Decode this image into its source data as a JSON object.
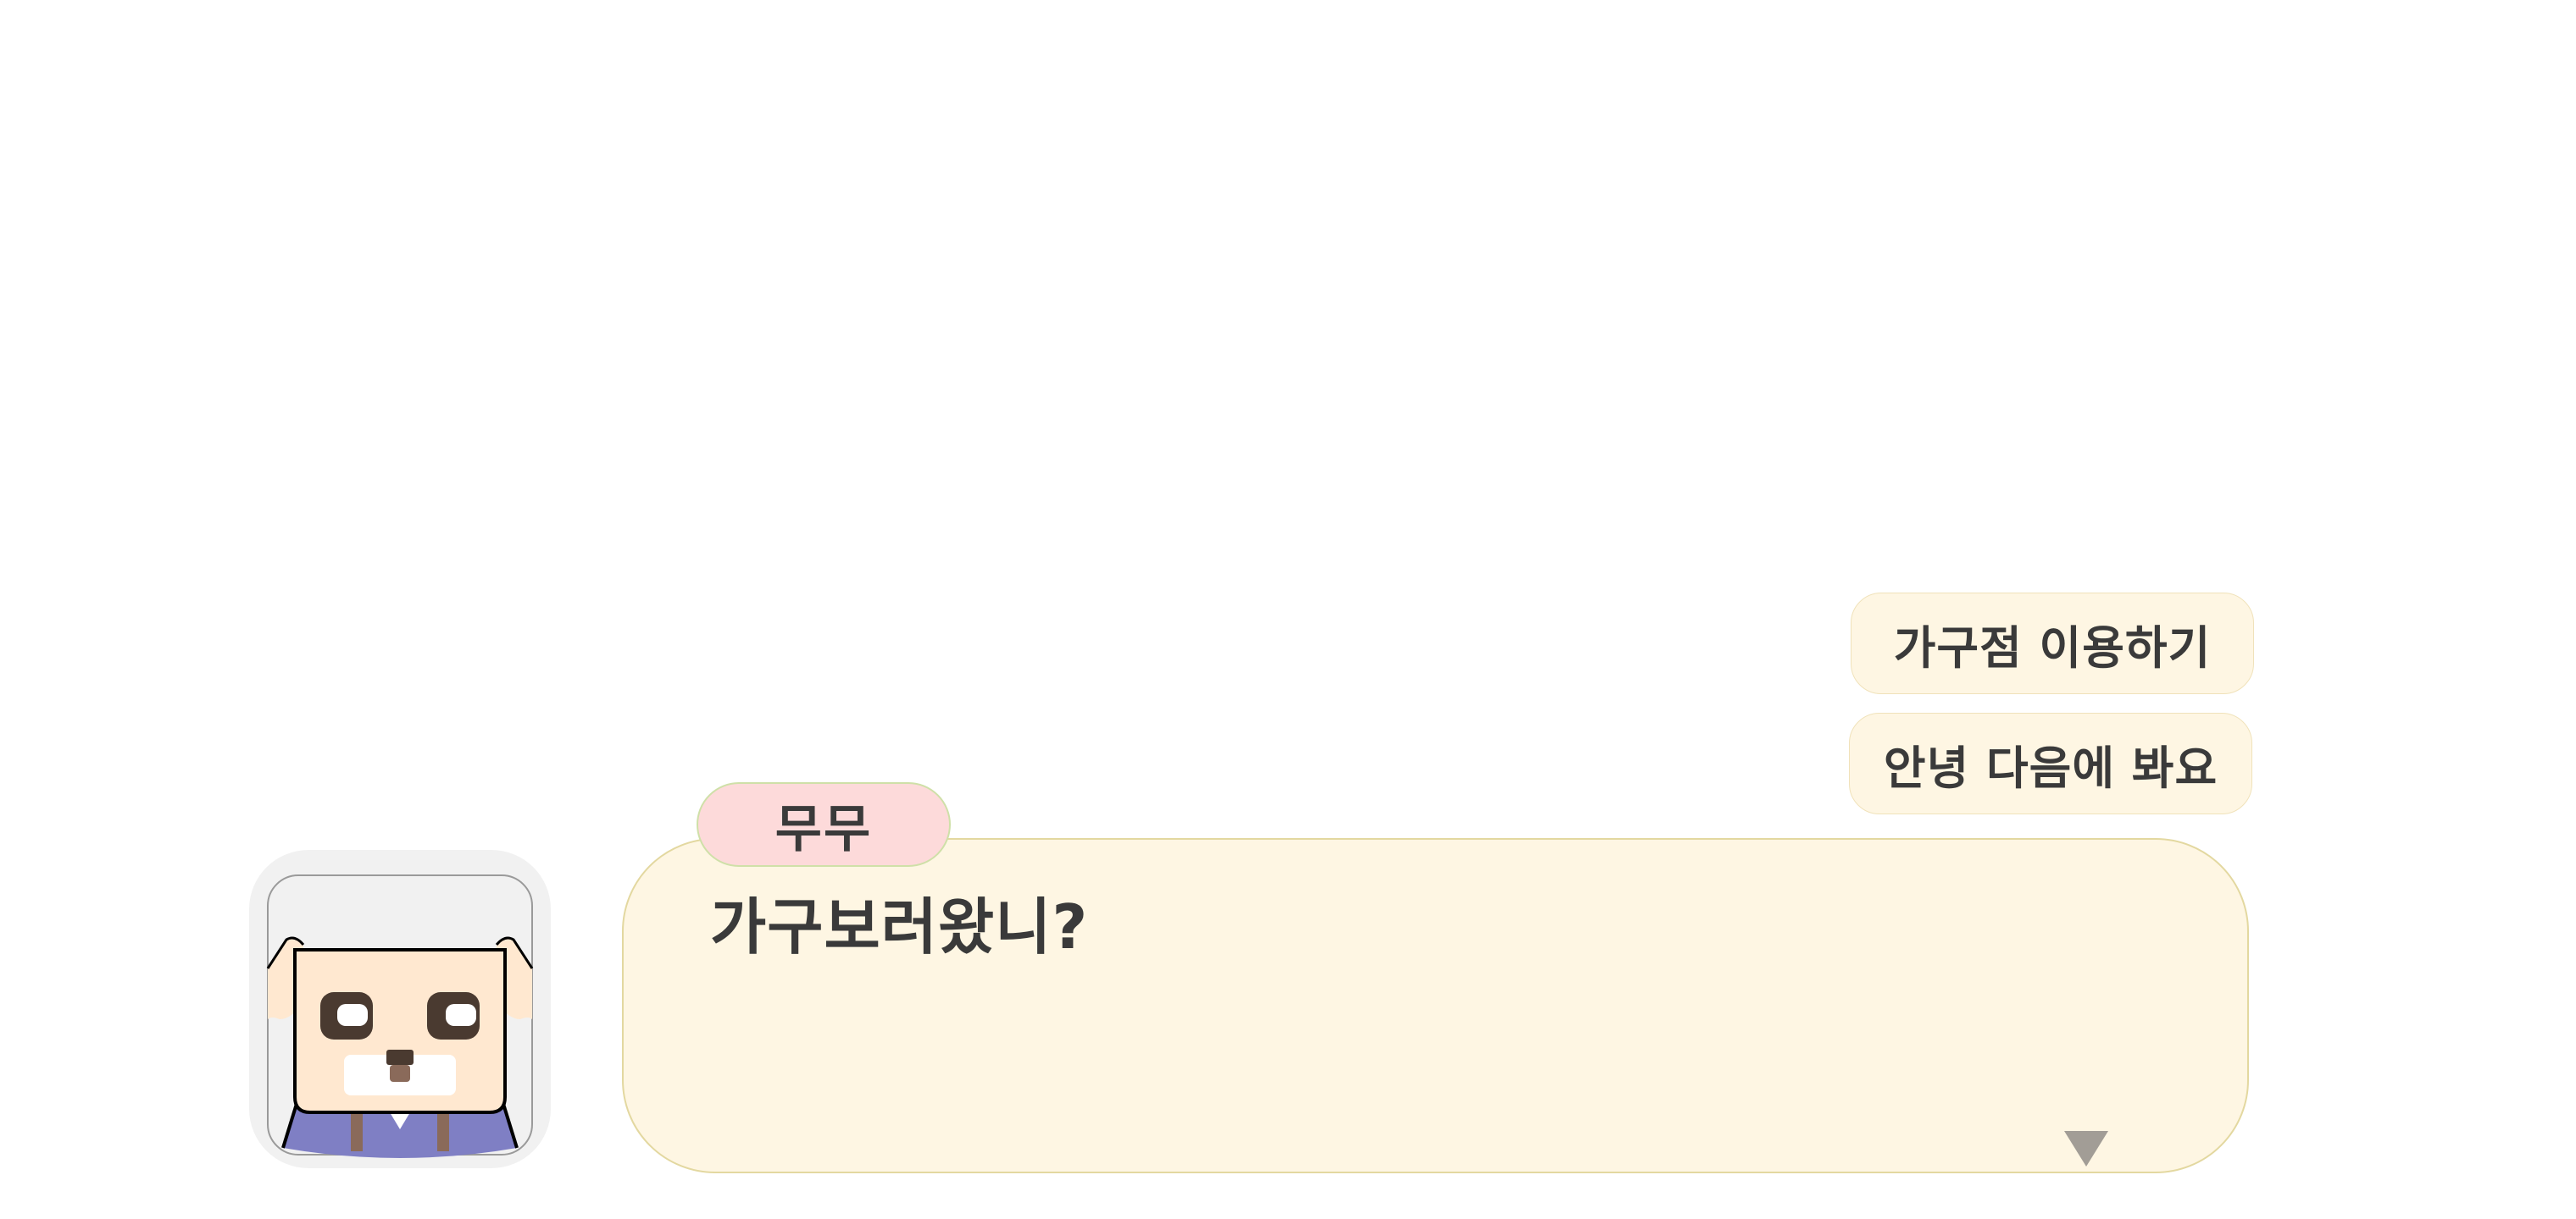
{
  "choices": [
    {
      "label": "가구점 이용하기"
    },
    {
      "label": "안녕 다음에 봐요"
    }
  ],
  "dialogue": {
    "speaker": "무무",
    "text": "가구보러왔니?",
    "next_icon": "triangle-down-icon"
  },
  "portrait": {
    "character": "white-haired-dog-shopkeeper",
    "colors": {
      "frame": "#f1f1f1",
      "face": "#ffe8d0",
      "eyes": "#4a3a30",
      "shirt": "#7f7fc4",
      "suspenders": "#8a6a5a"
    }
  },
  "colors": {
    "dialog_bg": "#fef6e3",
    "dialog_border": "#e3d8a0",
    "name_tag_bg": "#fddada",
    "text": "#3a3a3a",
    "next_icon": "#a29d96"
  }
}
